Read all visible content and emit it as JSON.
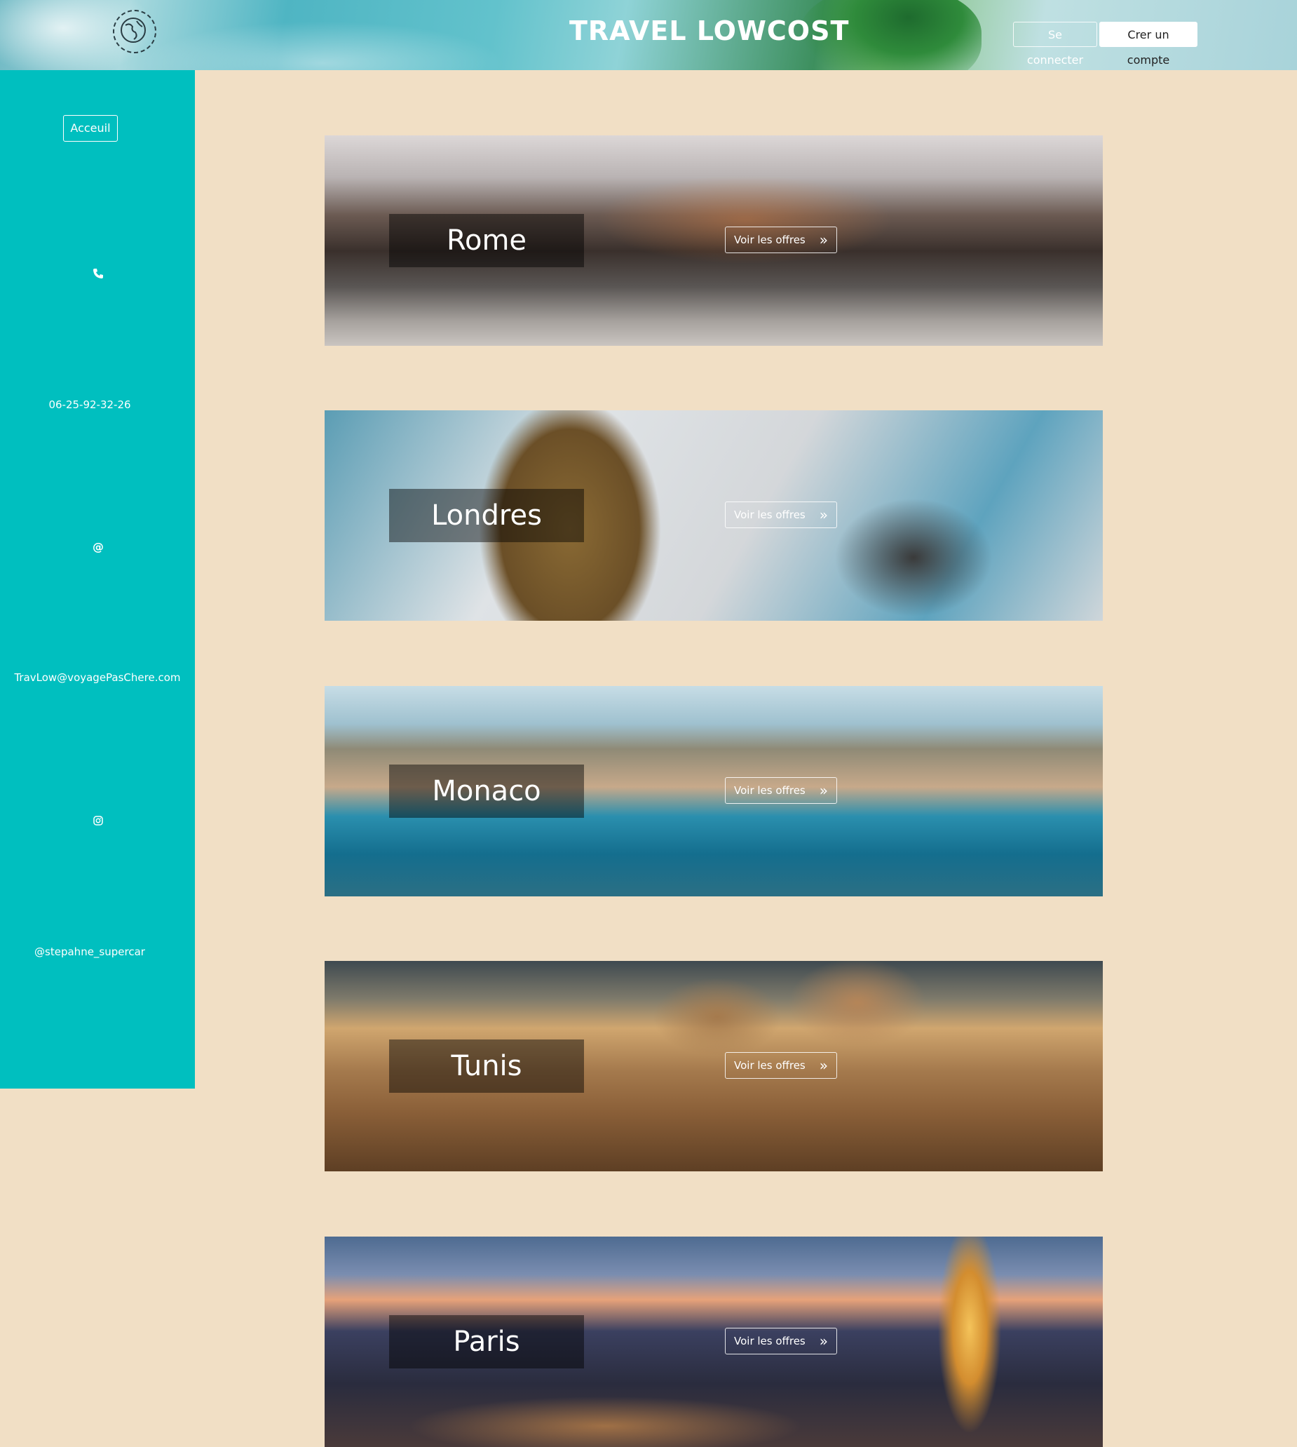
{
  "header": {
    "brand": "TRAVEL LOWCOST",
    "login_label": "Se connecter",
    "signup_label": "Crer un compte",
    "logo_icon": "globe-icon"
  },
  "sidebar": {
    "home_label": "Acceuil",
    "phone_icon": "phone-icon",
    "phone": "06-25-92-32-26",
    "email_icon": "at-icon",
    "email": "TravLow@voyagePasChere.com",
    "instagram_icon": "instagram-icon",
    "instagram": "@stepahne_supercar"
  },
  "destinations": [
    {
      "city": "Rome",
      "cta": "Voir les offres"
    },
    {
      "city": "Londres",
      "cta": "Voir les offres"
    },
    {
      "city": "Monaco",
      "cta": "Voir les offres"
    },
    {
      "city": "Tunis",
      "cta": "Voir les offres"
    },
    {
      "city": "Paris",
      "cta": "Voir les offres"
    }
  ],
  "colors": {
    "sidebar": "#00bfbf",
    "page_background": "#f1dfc5",
    "text_light": "#ffffff"
  }
}
